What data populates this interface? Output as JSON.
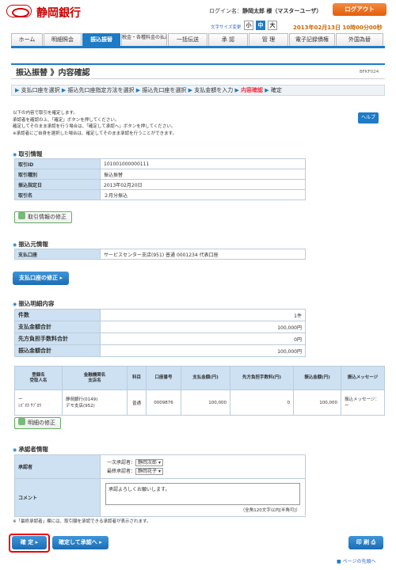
{
  "header": {
    "bank_name": "静岡銀行",
    "login_prefix": "ログイン名：",
    "login_user": "静岡太郎 様（マスターユーザ）",
    "logout_label": "ログアウト",
    "font_size_label": "文字サイズ変更",
    "font_sizes": [
      "小",
      "中",
      "大"
    ],
    "datetime": "2013年02月13日  10時00分00秒"
  },
  "nav": [
    "ホーム",
    "明細照会",
    "振込振替",
    "税金・各種料金の払込み",
    "一括伝送",
    "承 認",
    "管 理",
    "電子記録債権",
    "外国為替"
  ],
  "page": {
    "title": "振込振替 》内容確認",
    "screen_id": "BFKF024",
    "steps": [
      "支払口座を選択",
      "振込先口座指定方法を選択",
      "振込先口座を選択",
      "支払金額を入力",
      "内容確認",
      "確定"
    ],
    "steps_current_index": 4,
    "help_label": "ヘルプ",
    "intro_lines": [
      "以下の内容で取引を確定します。",
      "承認者を確認の上、「確定」ボタンを押してください。",
      "確定してそのまま承認を行う場合は、「確定して承認へ」ボタンを押してください。",
      "※承認者にご自身を選択した場合は、確定してそのまま承認を行うことができます。"
    ]
  },
  "transaction": {
    "title": "取引情報",
    "rows": [
      {
        "label": "取引ID",
        "value": "101001000000111"
      },
      {
        "label": "取引種別",
        "value": "振込振替"
      },
      {
        "label": "振込指定日",
        "value": "2013年02月20日"
      },
      {
        "label": "取引名",
        "value": "２月分振込"
      }
    ],
    "edit_label": "取引情報の修正"
  },
  "source": {
    "title": "振込元情報",
    "label": "支払口座",
    "value": "サービスセンター支店(951) 普通 0001234 代表口座",
    "edit_label": "支払口座の修正"
  },
  "detail": {
    "title": "振込明細内容",
    "summary": [
      {
        "label": "件数",
        "value": "1件"
      },
      {
        "label": "支払金額合計",
        "value": "100,000円"
      },
      {
        "label": "先方負担手数料合計",
        "value": "0円"
      },
      {
        "label": "振込金額合計",
        "value": "100,000円"
      }
    ],
    "columns": [
      "登録名\n受取人名",
      "金融機関名\n支店名",
      "科目",
      "口座番号",
      "支払金額(円)",
      "先方負担手数料(円)",
      "振込金額(円)",
      "振込メッセージ"
    ],
    "row": {
      "registered_name": "ー",
      "payee_name": "ｼｽﾞｵｶ ｻﾌﾞﾛｳ",
      "bank": "静岡銀行(0149)",
      "branch": "デモ支店(952)",
      "type": "普通",
      "account": "0009876",
      "amount": "100,000",
      "fee": "0",
      "transfer": "100,000",
      "message_label": "振込メッセージ：",
      "message": "ー"
    },
    "edit_label": "明細の修正"
  },
  "approver": {
    "title": "承認者情報",
    "approver_label": "承認者",
    "first_label": "一次承認者：",
    "first_value": "静岡次郎",
    "final_label": "最終承認者：",
    "final_value": "静岡花子",
    "comment_label": "コメント",
    "comment_value": "承認よろしくお願いします。",
    "comment_hint": "（全角120文字以内[半角可]）",
    "note": "※「最終承認者」欄には、取引額を承認できる承認者が表示されます。"
  },
  "actions": {
    "confirm_label": "確 定",
    "confirm_approve_label": "確定して承認へ",
    "print_label": "印 刷",
    "page_top_label": "ページの先頭へ"
  },
  "colors": {
    "brand_red": "#cc0000",
    "nav_blue": "#1e7bc6",
    "logout_orange": "#e35f0c",
    "table_header": "#cde1f2",
    "highlight": "#ee0000"
  }
}
